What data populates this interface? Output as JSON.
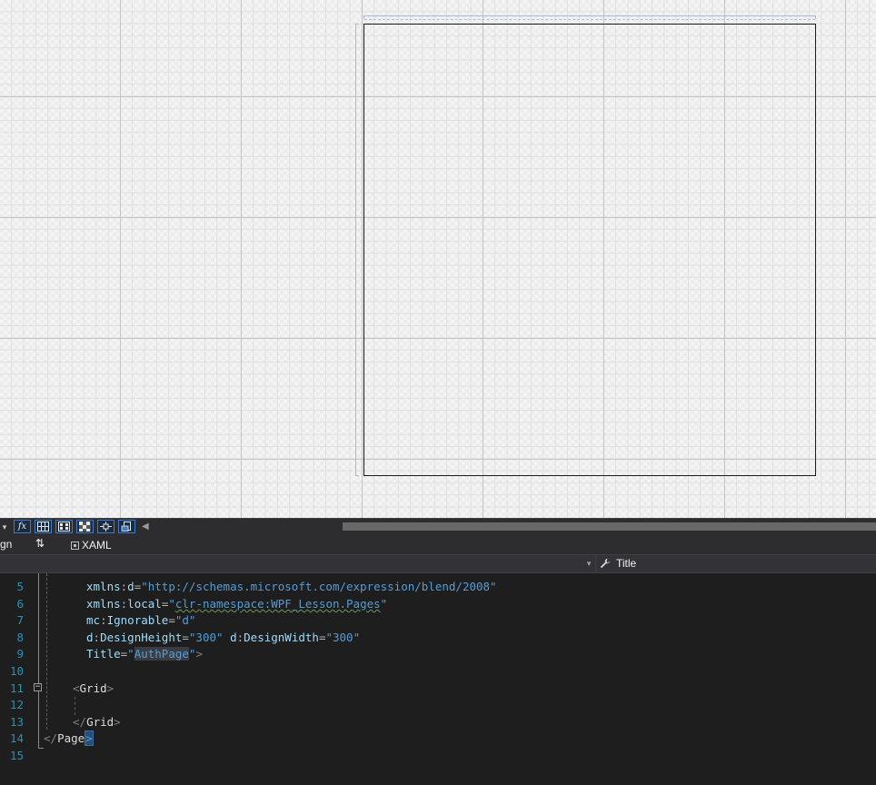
{
  "designer": {
    "toolbar": {
      "dropdown_glyph": "▾",
      "buttons": [
        {
          "name": "formula-button",
          "glyph": "fx"
        },
        {
          "name": "grid-button",
          "glyph": ""
        },
        {
          "name": "snap-grid-button",
          "glyph": ""
        },
        {
          "name": "transparency-button",
          "glyph": ""
        },
        {
          "name": "snap-lines-button",
          "glyph": ""
        },
        {
          "name": "project-code-button",
          "glyph": ""
        }
      ],
      "scroll_left_glyph": "◀"
    }
  },
  "tabs": {
    "design_label": "gn",
    "swap_glyph": "⇅",
    "xaml_label": "XAML"
  },
  "navbar": {
    "left_value": "",
    "right_label": "Title",
    "right_icon": "wrench-icon"
  },
  "editor": {
    "lines": [
      {
        "no": "5"
      },
      {
        "no": "6"
      },
      {
        "no": "7"
      },
      {
        "no": "8"
      },
      {
        "no": "9"
      },
      {
        "no": "10"
      },
      {
        "no": "11"
      },
      {
        "no": "12"
      },
      {
        "no": "13"
      },
      {
        "no": "14"
      },
      {
        "no": "15"
      }
    ],
    "l5": {
      "prefix": "xmlns",
      "sep": ":",
      "attr": "d",
      "eq": "=",
      "value": "\"http://schemas.microsoft.com/expression/blend/2008\""
    },
    "l6": {
      "prefix": "xmlns",
      "sep": ":",
      "attr": "local",
      "eq": "=",
      "q1": "\"",
      "value": "clr-namespace:WPF_Lesson.Pages",
      "q2": "\""
    },
    "l7": {
      "prefix": "mc",
      "sep": ":",
      "attr": "Ignorable",
      "eq": "=",
      "value": "\"d\""
    },
    "l8": {
      "prefix1": "d",
      "sep1": ":",
      "attr1": "DesignHeight",
      "eq1": "=",
      "value1": "\"300\"",
      "prefix2": "d",
      "sep2": ":",
      "attr2": "DesignWidth",
      "eq2": "=",
      "value2": "\"300\""
    },
    "l9": {
      "attr": "Title",
      "eq": "=",
      "q1": "\"",
      "value": "AuthPage",
      "q2": "\"",
      "close": ">"
    },
    "l11": {
      "open": "<",
      "tag": "Grid",
      "close": ">"
    },
    "l13": {
      "open": "</",
      "tag": "Grid",
      "close": ">"
    },
    "l14": {
      "open": "</",
      "tag": "Page",
      "close": ">"
    }
  }
}
